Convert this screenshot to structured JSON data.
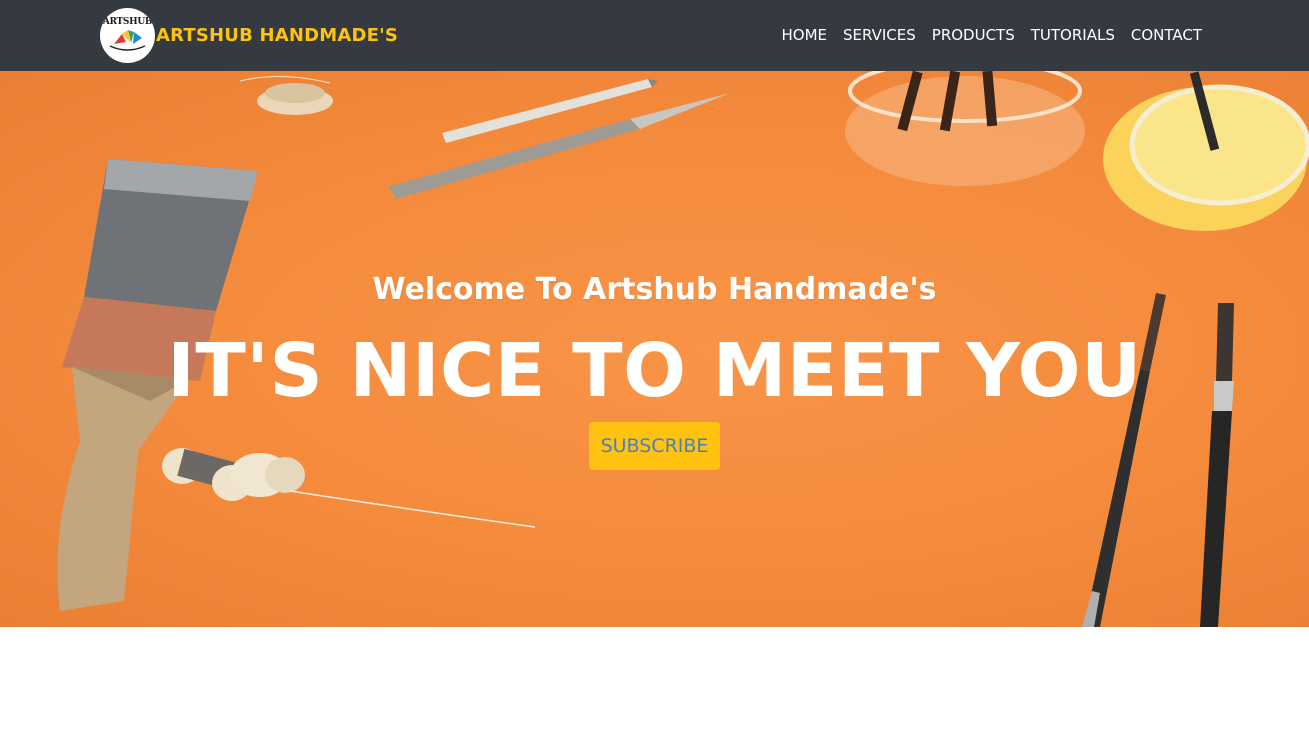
{
  "brand": {
    "logo_text": "ARTSHUB",
    "name": "ARTSHUB HANDMADE'S"
  },
  "nav": {
    "items": [
      {
        "label": "HOME"
      },
      {
        "label": "SERVICES"
      },
      {
        "label": "PRODUCTS"
      },
      {
        "label": "TUTORIALS"
      },
      {
        "label": "CONTACT"
      }
    ]
  },
  "hero": {
    "subheading": "Welcome To Artshub Handmade's",
    "heading": "IT'S NICE TO MEET YOU",
    "cta_label": "SUBSCRIBE"
  },
  "colors": {
    "navbar": "#343a40",
    "brand_accent": "#fec20f",
    "hero_background": "#f48a3c",
    "cta_text": "#4a7fc1"
  }
}
